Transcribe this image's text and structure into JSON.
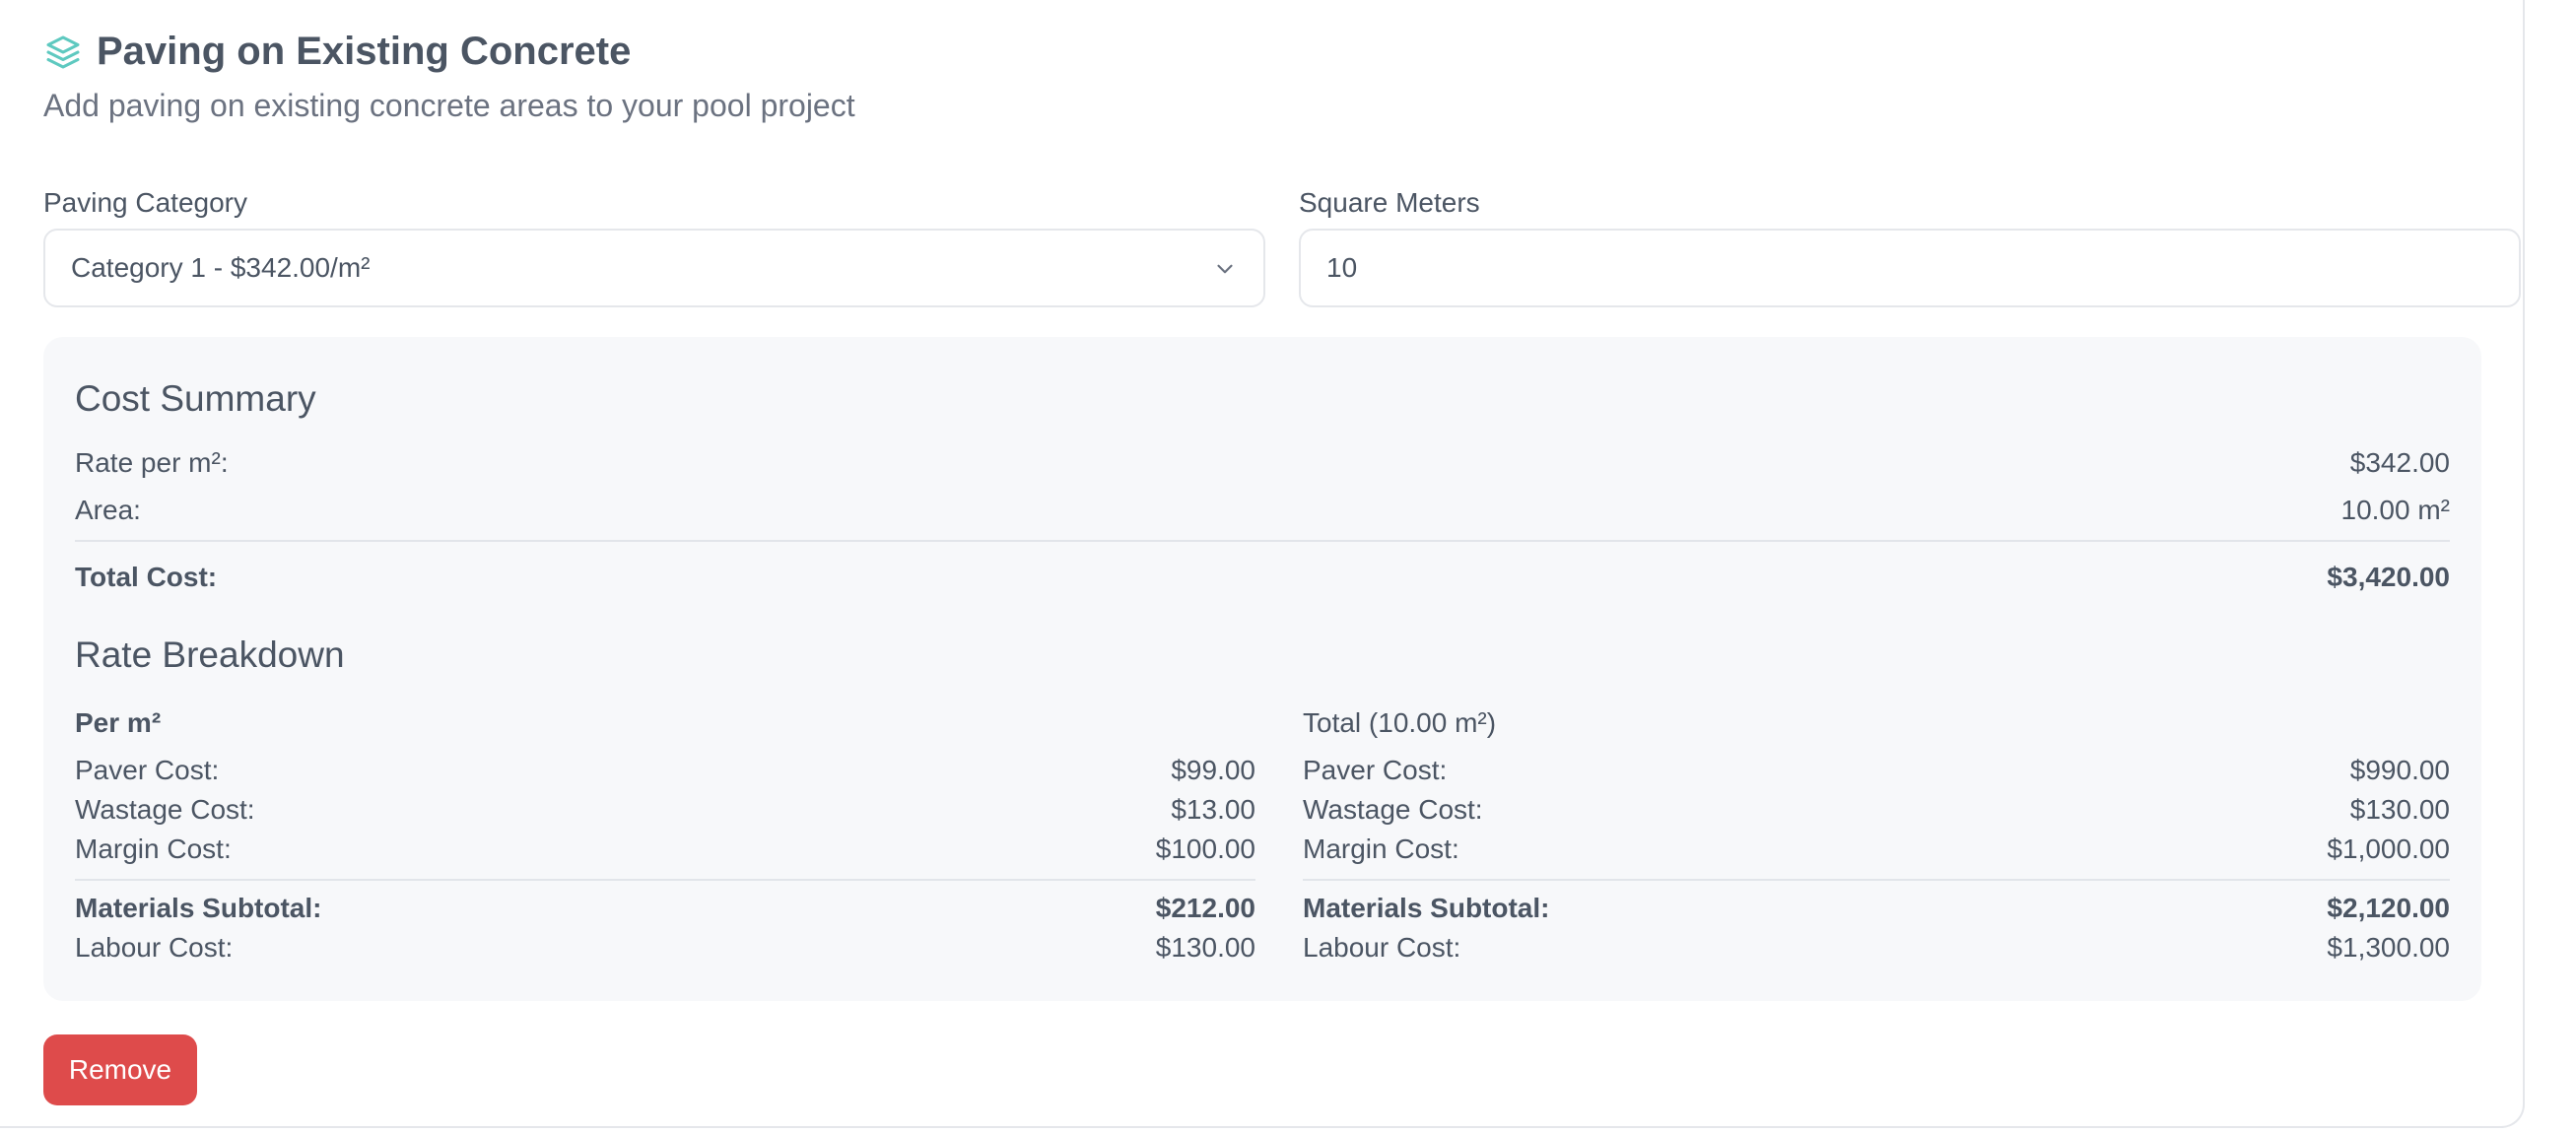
{
  "header": {
    "icon": "layers-icon",
    "title": "Paving on Existing Concrete",
    "subtitle": "Add paving on existing concrete areas to your pool project"
  },
  "form": {
    "category_label": "Paving Category",
    "category_value": "Category 1 - $342.00/m²",
    "sqm_label": "Square Meters",
    "sqm_value": "10"
  },
  "summary": {
    "title": "Cost Summary",
    "rate_label": "Rate per m²:",
    "rate_value": "$342.00",
    "area_label": "Area:",
    "area_value": "10.00 m²",
    "total_label": "Total Cost:",
    "total_value": "$3,420.00"
  },
  "breakdown": {
    "title": "Rate Breakdown",
    "per_m2": {
      "title": "Per m²",
      "paver_label": "Paver Cost:",
      "paver_value": "$99.00",
      "wastage_label": "Wastage Cost:",
      "wastage_value": "$13.00",
      "margin_label": "Margin Cost:",
      "margin_value": "$100.00",
      "materials_label": "Materials Subtotal:",
      "materials_value": "$212.00",
      "labour_label": "Labour Cost:",
      "labour_value": "$130.00"
    },
    "total": {
      "title": "Total (10.00 m²)",
      "paver_label": "Paver Cost:",
      "paver_value": "$990.00",
      "wastage_label": "Wastage Cost:",
      "wastage_value": "$130.00",
      "margin_label": "Margin Cost:",
      "margin_value": "$1,000.00",
      "materials_label": "Materials Subtotal:",
      "materials_value": "$2,120.00",
      "labour_label": "Labour Cost:",
      "labour_value": "$1,300.00"
    }
  },
  "actions": {
    "remove_label": "Remove"
  },
  "colors": {
    "accent": "#5ec9c0",
    "danger": "#de4b4b",
    "panel": "#f7f8fa"
  }
}
